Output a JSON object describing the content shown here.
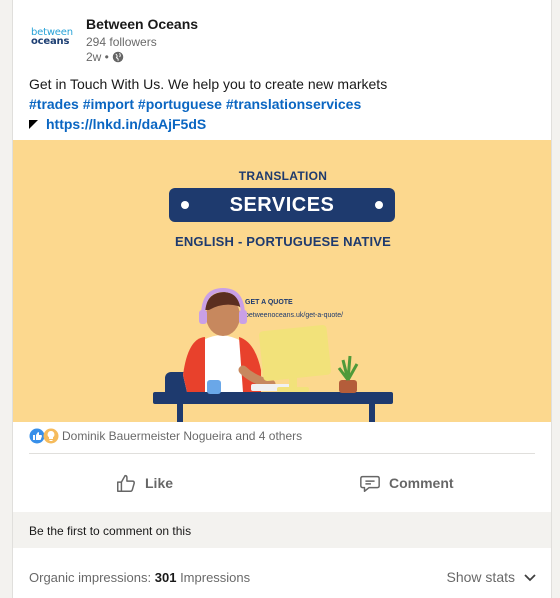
{
  "post": {
    "company": "Between Oceans",
    "logo_line1": "between",
    "logo_line2": "oceans",
    "followers": "294 followers",
    "time": "2w •",
    "text_line1": "Get in Touch With Us. We help you to create new markets",
    "hashtags": "#trades #import #portuguese #translationservices",
    "link": "https://lnkd.in/daAjF5dS"
  },
  "image": {
    "title": "TRANSLATION",
    "services": "SERVICES",
    "native": "ENGLISH - PORTUGUESE NATIVE",
    "quote_title": "GET A QUOTE",
    "quote_url": "betweenoceans.uk/get-a-quote/",
    "colors": {
      "background": "#fcd88e",
      "navy": "#1e3a6e"
    }
  },
  "reactions": {
    "text": "Dominik Bauermeister Nogueira and 4 others"
  },
  "actions": {
    "like": "Like",
    "comment": "Comment"
  },
  "first_comment": "Be the first to comment on this",
  "footer": {
    "impressions_label": "Organic impressions:",
    "impressions_count": "301",
    "impressions_unit": "Impressions",
    "show_stats": "Show stats"
  },
  "colors": {
    "link": "#0a66c2"
  }
}
